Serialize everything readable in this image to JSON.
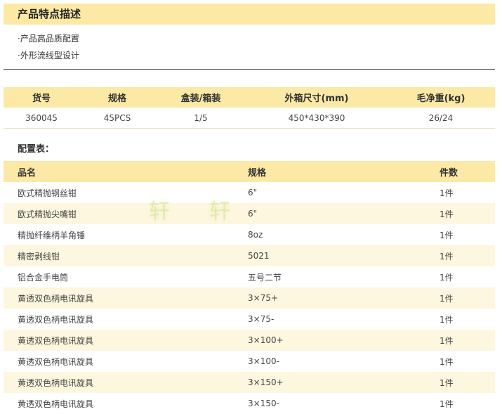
{
  "section_title": "产品特点描述",
  "features": [
    "·产品高品质配置",
    "·外形流线型设计"
  ],
  "spec_table": {
    "headers": [
      "货号",
      "规格",
      "盒装/箱装",
      "外箱尺寸(mm)",
      "毛净重(kg)"
    ],
    "row": [
      "360045",
      "45PCS",
      "1/5",
      "450*430*390",
      "26/24"
    ]
  },
  "config_title": "配置表：",
  "config_table": {
    "headers": [
      "品名",
      "规格",
      "件数"
    ],
    "rows": [
      [
        "欧式精抛钢丝钳",
        "6\"",
        "1件"
      ],
      [
        "欧式精抛尖嘴钳",
        "6\"",
        "1件"
      ],
      [
        "精抛纤维柄羊角锤",
        "8oz",
        "1件"
      ],
      [
        "精密剥线钳",
        "5021",
        "1件"
      ],
      [
        "铝合金手电筒",
        "五号二节",
        "1件"
      ],
      [
        "黄透双色柄电讯旋具",
        "3×75+",
        "1件"
      ],
      [
        "黄透双色柄电讯旋具",
        "3×75-",
        "1件"
      ],
      [
        "黄透双色柄电讯旋具",
        "3×100+",
        "1件"
      ],
      [
        "黄透双色柄电讯旋具",
        "3×100-",
        "1件"
      ],
      [
        "黄透双色柄电讯旋具",
        "3×150+",
        "1件"
      ],
      [
        "黄透双色柄电讯旋具",
        "3×150-",
        "1件"
      ]
    ]
  },
  "watermark": "轩",
  "colors": {
    "header_bg": "#fbe9a5",
    "alt_row_bg": "#fdf7df",
    "divider": "#444444"
  }
}
